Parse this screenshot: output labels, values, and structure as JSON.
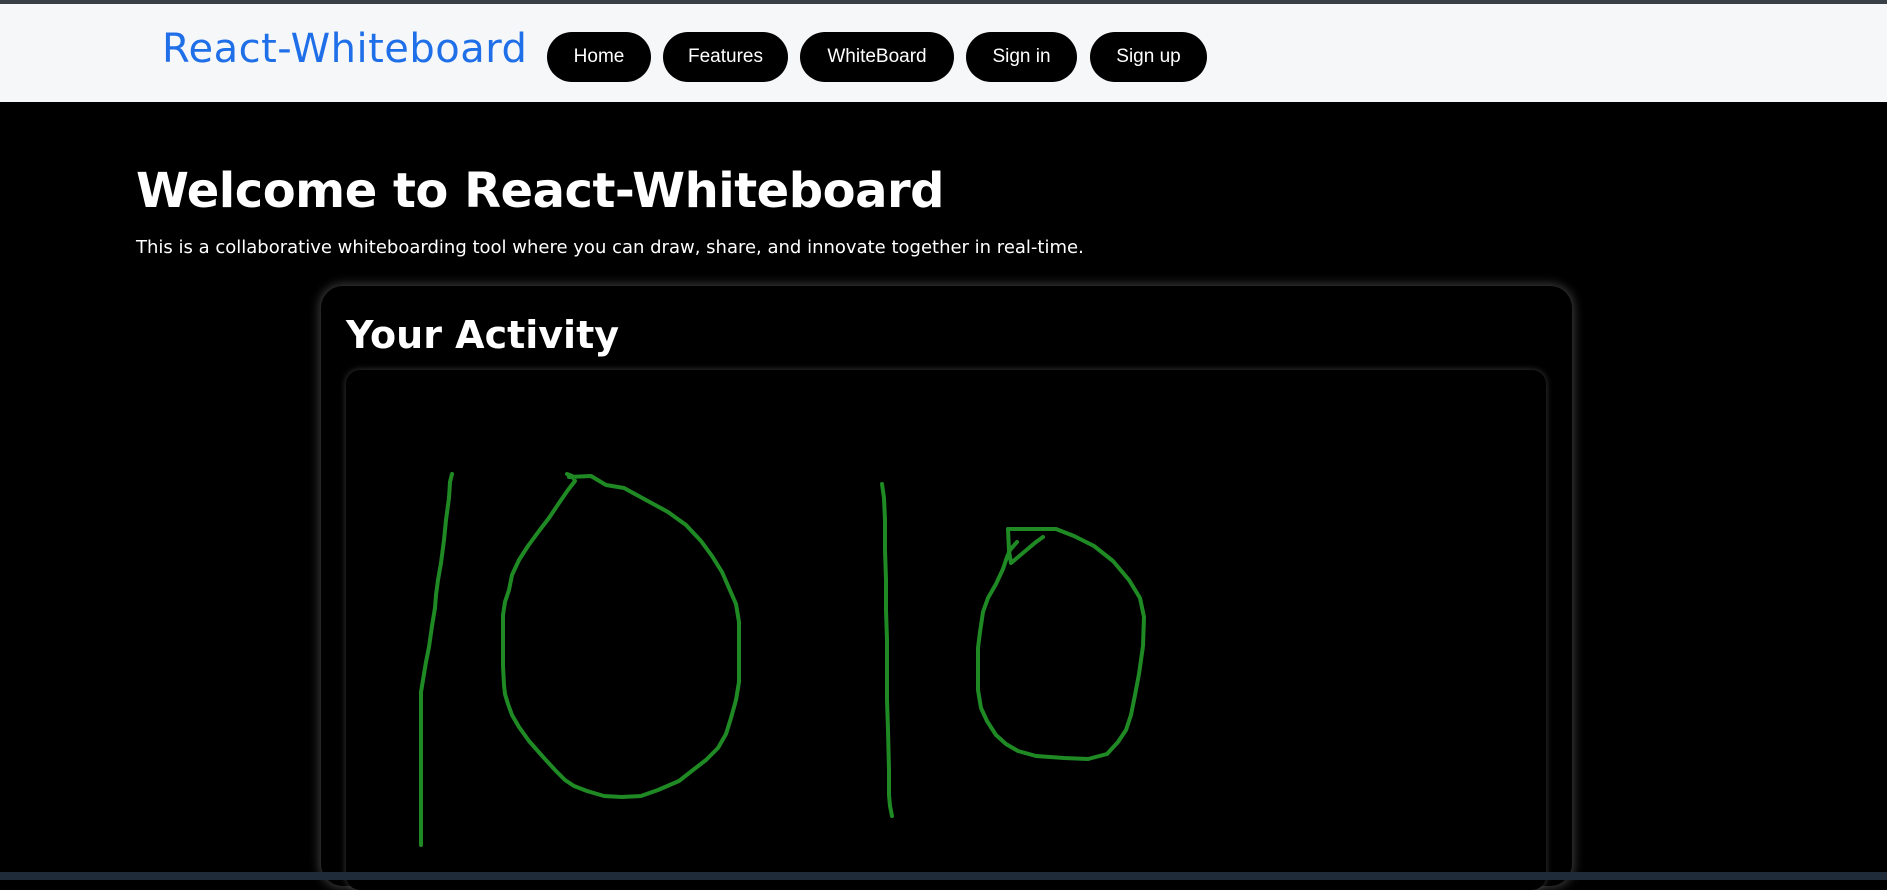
{
  "navbar": {
    "brand": "React-Whiteboard",
    "items": [
      {
        "label": "Home"
      },
      {
        "label": "Features"
      },
      {
        "label": "WhiteBoard"
      },
      {
        "label": "Sign in"
      },
      {
        "label": "Sign up"
      }
    ]
  },
  "hero": {
    "title": "Welcome to React-Whiteboard",
    "subtitle": "This is a collaborative whiteboarding tool where you can draw, share, and innovate together in real-time."
  },
  "activity": {
    "title": "Your Activity",
    "stroke_color": "#1f8a24"
  },
  "colors": {
    "brand": "#1e6fe8",
    "nav_bg": "#f6f7f9",
    "button_bg": "#000000",
    "page_bg": "#000000"
  }
}
